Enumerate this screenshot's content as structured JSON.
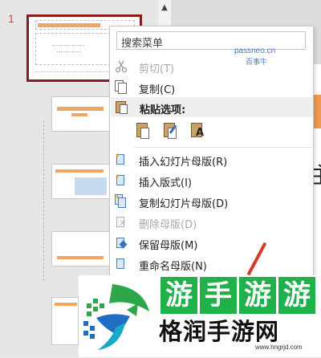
{
  "thumbnail_pane": {
    "slide_number": "1"
  },
  "context_menu": {
    "search_placeholder": "搜索菜单",
    "items": {
      "cut": "剪切(T)",
      "copy": "复制(C)",
      "paste_options_header": "粘贴选项:",
      "insert_slide_master": "插入幻灯片母版(R)",
      "insert_layout": "插入版式(I)",
      "duplicate_slide_master": "复制幻灯片母版(D)",
      "delete_master": "删除母版(D)",
      "preserve_master": "保留母版(M)",
      "rename_master": "重命名母版(N)"
    }
  },
  "watermark": {
    "line1": "passneo.cn",
    "line2": "百事牛"
  },
  "banner": {
    "green_chars": [
      "游",
      "手",
      "游"
    ],
    "logo_text": "格润手游网",
    "logo_url": "www.hngrjd.com"
  },
  "editor": {
    "glyph": "主"
  },
  "colors": {
    "selection_border": "#8b1a1a",
    "accent_orange": "#f19a4a",
    "banner_green": "#21b14b"
  }
}
